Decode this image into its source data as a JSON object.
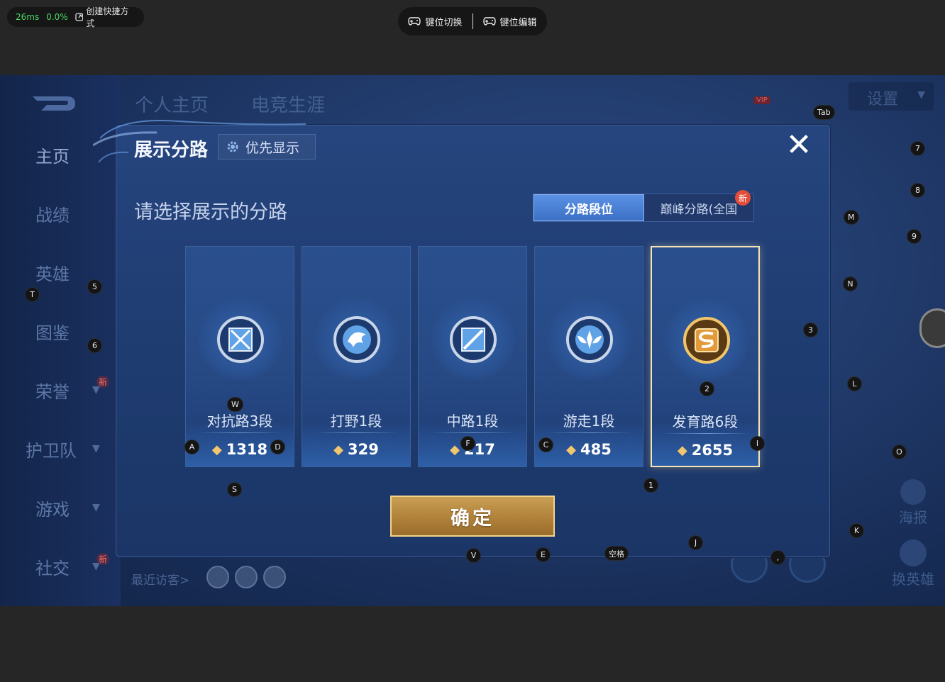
{
  "overlay": {
    "latency": "26ms",
    "loss": "0.0%",
    "create_shortcut": "创建快捷方式",
    "key_switch": "键位切换",
    "key_edit": "键位编辑"
  },
  "game": {
    "nav": {
      "home": "主页",
      "record": "战绩",
      "hero": "英雄",
      "atlas": "图鉴",
      "honor": "荣誉",
      "guard": "护卫队",
      "games": "游戏",
      "social": "社交",
      "new_badge": "新"
    },
    "top_tabs": [
      "个人主页",
      "电竞生涯"
    ],
    "settings": "设置",
    "vip": "VIP",
    "poster": "海报",
    "change_hero": "换英雄",
    "recent_visitors": "最近访客>"
  },
  "modal": {
    "title": "展示分路",
    "priority_label": "优先显示",
    "subtitle": "请选择展示的分路",
    "tab_rank": "分路段位",
    "tab_peak": "巅峰分路(全国",
    "tab_new": "新",
    "confirm": "确定",
    "close": "✕",
    "lanes": [
      {
        "name": "对抗路3段",
        "score": "1318",
        "selected": false
      },
      {
        "name": "打野1段",
        "score": "329",
        "selected": false
      },
      {
        "name": "中路1段",
        "score": "217",
        "selected": false
      },
      {
        "name": "游走1段",
        "score": "485",
        "selected": false
      },
      {
        "name": "发育路6段",
        "score": "2655",
        "selected": true
      }
    ]
  },
  "keys": {
    "tab": "Tab",
    "k7": "7",
    "k8": "8",
    "m": "M",
    "k9": "9",
    "t": "T",
    "k5": "5",
    "n": "N",
    "k3": "3",
    "k6": "6",
    "l": "L",
    "k2": "2",
    "w": "W",
    "a": "A",
    "d": "D",
    "f": "F",
    "c": "C",
    "i": "I",
    "o": "O",
    "s": "S",
    "k1": "1",
    "k": "K",
    "j": "J",
    "v": "V",
    "e": "E",
    "space": "空格",
    "comma": ","
  },
  "colors": {
    "accent_gold": "#f2d48a",
    "tab_active": "#4a82d8",
    "new_badge": "#e44c3a",
    "latency_green": "#4cd964"
  }
}
